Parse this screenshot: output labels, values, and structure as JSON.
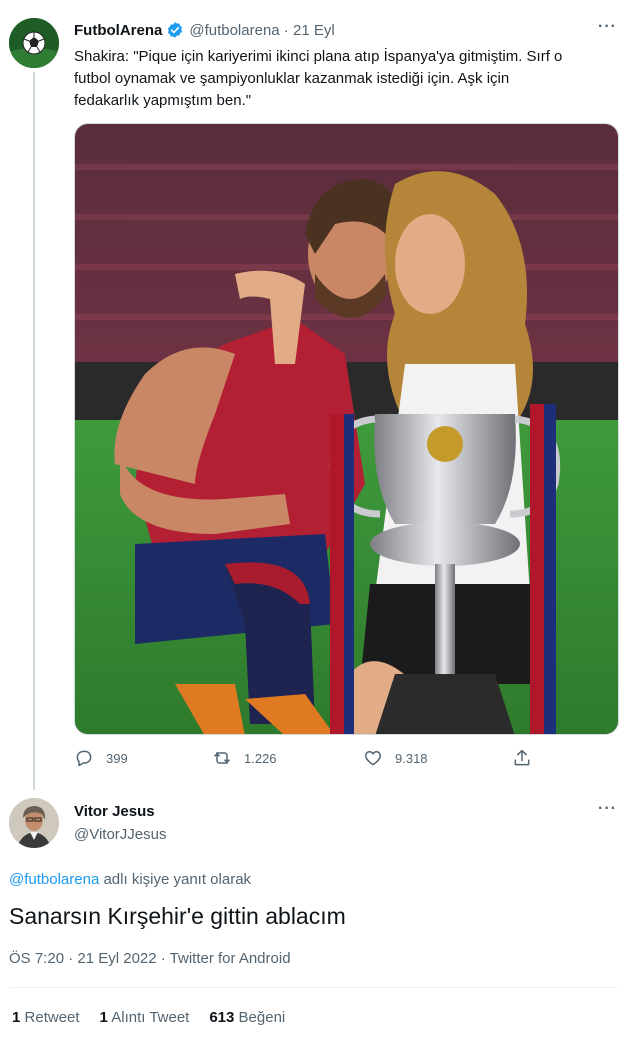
{
  "tweet": {
    "author_name": "FutbolArena",
    "author_handle": "@futbolarena",
    "date_sep": " · ",
    "date": "21 Eyl",
    "text": "Shakira: \"Pique için kariyerimi ikinci plana atıp İspanya'ya gitmiştim. Sırf o\nfutbol oynamak ve şampiyonluklar kazanmak istediği için. Aşk için\nfedakarlık yapmıştım ben.\"",
    "more": "···",
    "replies": "399",
    "retweets": "1.226",
    "likes": "9.318",
    "icons": {
      "reply": "reply-icon",
      "retweet": "retweet-icon",
      "like": "heart-icon",
      "share": "share-icon",
      "verified": "verified-badge-icon"
    }
  },
  "reply": {
    "author_name": "Vitor Jesus",
    "author_handle": "@VitorJJesus",
    "more": "···",
    "reply_to_handle": "@futbolarena",
    "reply_to_suffix": " adlı kişiye yanıt olarak",
    "text": "Sanarsın Kırşehir'e gittin ablacım",
    "meta": "ÖS 7:20 · 21 Eyl 2022 · Twitter for Android",
    "stats": [
      {
        "count": "1",
        "label": "Retweet"
      },
      {
        "count": "1",
        "label": "Alıntı Tweet"
      },
      {
        "count": "613",
        "label": "Beğeni"
      }
    ]
  },
  "colors": {
    "accent": "#1d9bf0",
    "secondary_text": "#536471",
    "primary_text": "#0f1419",
    "thread_line": "#cfd9de"
  }
}
